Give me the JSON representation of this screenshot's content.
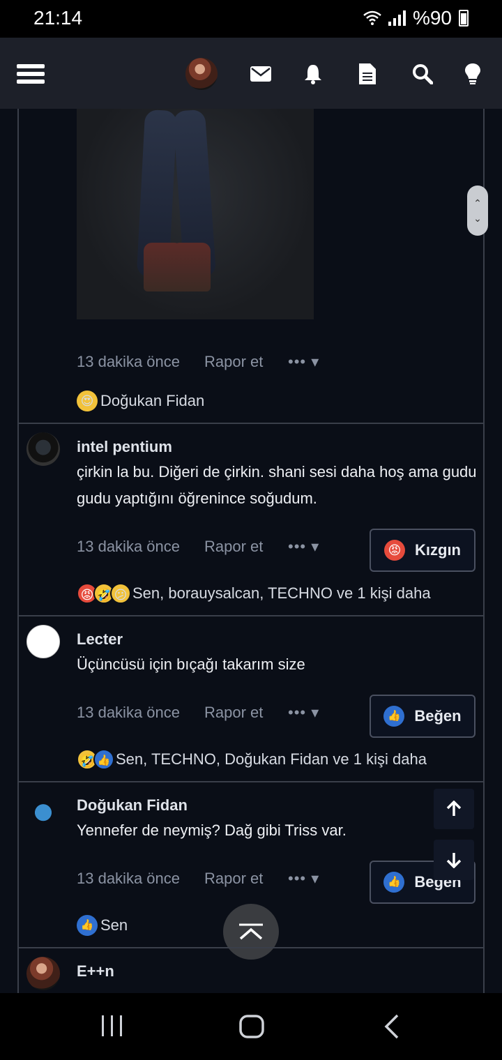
{
  "status": {
    "time": "21:14",
    "battery": "%90"
  },
  "header": {
    "icons": [
      "menu-icon",
      "avatar",
      "mail-icon",
      "bell-icon",
      "document-icon",
      "search-icon",
      "bulb-icon"
    ]
  },
  "comments": [
    {
      "id": "c0",
      "meta": {
        "time": "13 dakika önce",
        "report": "Rapor et",
        "more": "•••"
      },
      "reactions": {
        "names": "Doğukan Fidan"
      }
    },
    {
      "id": "c1",
      "author": "intel pentium",
      "text": "çirkin la bu. Diğeri de çirkin. shani sesi daha hoş ama gudu gudu yaptığını öğrenince soğudum.",
      "meta": {
        "time": "13 dakika önce",
        "report": "Rapor et",
        "more": "•••"
      },
      "button": "Kızgın",
      "reactions": {
        "names": "Sen, borauysalcan, TECHNO ve 1 kişi daha"
      }
    },
    {
      "id": "c2",
      "author": "Lecter",
      "text": "Üçüncüsü için bıçağı takarım size",
      "meta": {
        "time": "13 dakika önce",
        "report": "Rapor et",
        "more": "•••"
      },
      "button": "Beğen",
      "reactions": {
        "names": "Sen, TECHNO, Doğukan Fidan ve 1 kişi daha"
      }
    },
    {
      "id": "c3",
      "author": "Doğukan Fidan",
      "text": "Yennefer de neymiş? Dağ gibi Triss var.",
      "meta": {
        "time": "13 dakika önce",
        "report": "Rapor et",
        "more": "•••"
      },
      "button": "Beğen",
      "reactions": {
        "names": "Sen"
      }
    },
    {
      "id": "c4",
      "author": "E++n"
    }
  ],
  "colors": {
    "background": "#0a0e17",
    "header": "#1d2029",
    "accent_like": "#2f6fd0",
    "angry": "#e64b3c"
  }
}
